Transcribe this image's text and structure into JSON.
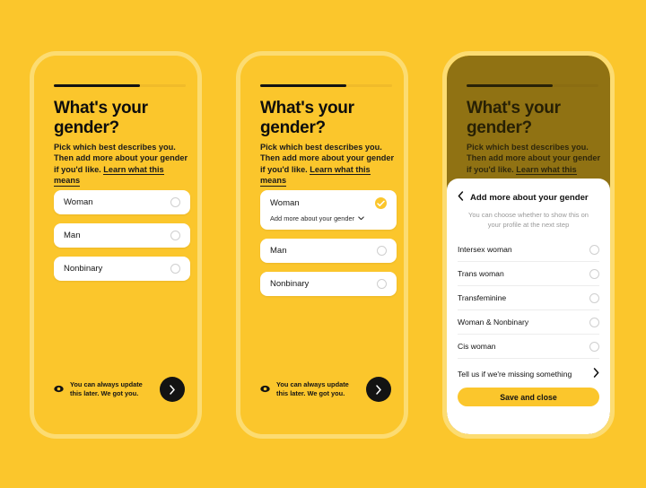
{
  "theme": {
    "background": "#fbc62c",
    "frame_border": "#fcdc72",
    "accent": "#fbc62c",
    "ink": "#0d0d0d",
    "card": "#ffffff",
    "scrim": "rgba(60,48,0,0.56)"
  },
  "screens": [
    {
      "id": "gender-question-default",
      "progress_percent": 65,
      "title": "What's your gender?",
      "subtitle_text": "Pick which best describes you. Then add more about your gender if you'd like. ",
      "subtitle_link": "Learn what this means",
      "options": [
        {
          "label": "Woman",
          "selected": false
        },
        {
          "label": "Man",
          "selected": false
        },
        {
          "label": "Nonbinary",
          "selected": false
        }
      ],
      "footer_icon": "eye-icon",
      "footer_text": "You can always update this later. We got you.",
      "next_icon": "chevron-right-icon"
    },
    {
      "id": "gender-question-selected",
      "progress_percent": 65,
      "title": "What's your gender?",
      "subtitle_text": "Pick which best describes you. Then add more about your gender if you'd like. ",
      "subtitle_link": "Learn what this means",
      "options": [
        {
          "label": "Woman",
          "selected": true,
          "sub_label": "Add more about your gender"
        },
        {
          "label": "Man",
          "selected": false
        },
        {
          "label": "Nonbinary",
          "selected": false
        }
      ],
      "footer_icon": "eye-icon",
      "footer_text": "You can always update this later. We got you.",
      "next_icon": "chevron-right-icon"
    },
    {
      "id": "gender-question-sheet-open",
      "progress_percent": 65,
      "title": "What's your gender?",
      "subtitle_text": "Pick which best describes you. Then add more about your gender if you'd like. ",
      "subtitle_link": "Learn what this means",
      "sheet": {
        "back_icon": "chevron-left-icon",
        "title": "Add more about your gender",
        "subtitle": "You can choose whether to show this on your profile at the next step",
        "items": [
          {
            "label": "Intersex woman",
            "control": "radio"
          },
          {
            "label": "Trans woman",
            "control": "radio"
          },
          {
            "label": "Transfeminine",
            "control": "radio"
          },
          {
            "label": "Woman & Nonbinary",
            "control": "radio"
          },
          {
            "label": "Cis woman",
            "control": "radio"
          },
          {
            "label": "Tell us if we're missing something",
            "control": "chevron"
          }
        ],
        "save_label": "Save and close"
      }
    }
  ]
}
